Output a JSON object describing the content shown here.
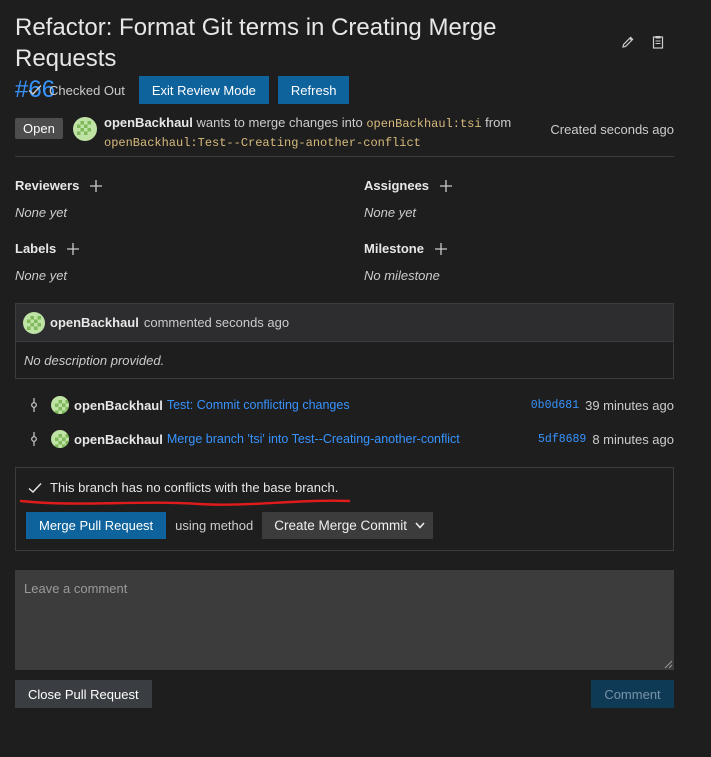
{
  "header": {
    "title": "Refactor: Format Git terms in Creating Merge Requests",
    "number": "#66",
    "edit_icon": "pencil-icon",
    "copy_icon": "clipboard-icon"
  },
  "actions": {
    "checked_out_label": "Checked Out",
    "exit_review_label": "Exit Review Mode",
    "refresh_label": "Refresh"
  },
  "status": {
    "badge": "Open",
    "author": "openBackhaul",
    "wants_text": "wants to merge changes into",
    "target_branch": "openBackhaul:tsi",
    "from_text": "from",
    "source_branch": "openBackhaul:Test--Creating-another-conflict",
    "created": "Created seconds ago"
  },
  "meta": {
    "reviewers": {
      "label": "Reviewers",
      "value": "None yet"
    },
    "assignees": {
      "label": "Assignees",
      "value": "None yet"
    },
    "labels": {
      "label": "Labels",
      "value": "None yet"
    },
    "milestone": {
      "label": "Milestone",
      "value": "No milestone"
    }
  },
  "comment": {
    "author": "openBackhaul",
    "action": "commented seconds ago",
    "body": "No description provided."
  },
  "commits": [
    {
      "author": "openBackhaul",
      "message": "Test: Commit conflicting changes",
      "sha": "0b0d681",
      "time": "39 minutes ago"
    },
    {
      "author": "openBackhaul",
      "message": "Merge branch 'tsi' into Test--Creating-another-conflict",
      "sha": "5df8689",
      "time": "8 minutes ago"
    }
  ],
  "merge": {
    "status_text": "This branch has no conflicts with the base branch.",
    "merge_button": "Merge Pull Request",
    "using_text": "using method",
    "method": "Create Merge Commit"
  },
  "compose": {
    "placeholder": "Leave a comment",
    "close_button": "Close Pull Request",
    "comment_button": "Comment"
  },
  "colors": {
    "background": "#1e1e1e",
    "accent": "#0e639c",
    "link": "#3794ff",
    "branch": "#d7ba7d",
    "annotation": "#e01b1b"
  }
}
